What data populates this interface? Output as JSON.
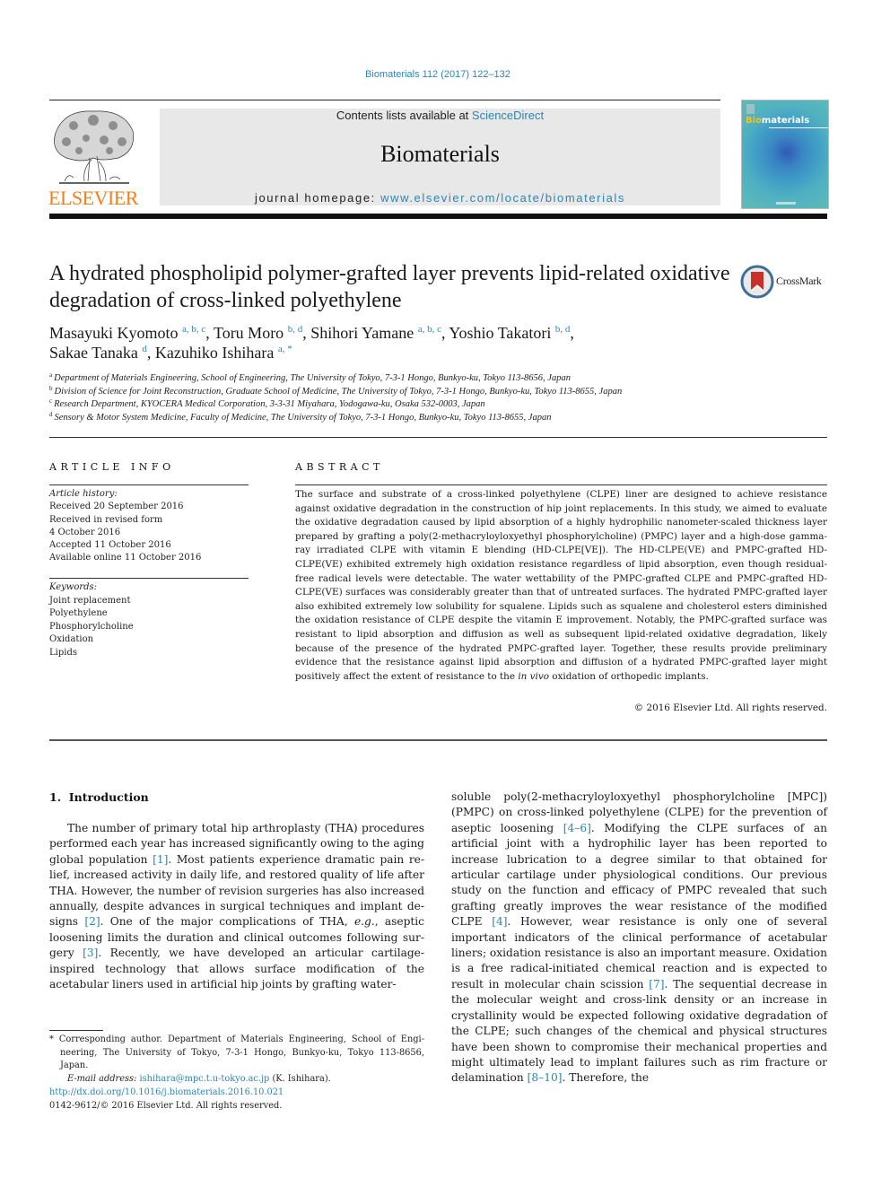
{
  "header": {
    "citation": "Biomaterials 112 (2017) 122–132",
    "publisher_logo_text": "ELSEVIER",
    "contents_prefix": "Contents lists available at ",
    "contents_link": "ScienceDirect",
    "journal_name": "Biomaterials",
    "homepage_prefix": "journal homepage: ",
    "homepage_link": "www.elsevier.com/locate/biomaterials",
    "cover_title_highlight": "Bio",
    "cover_title_rest": "materials"
  },
  "article": {
    "title": "A hydrated phospholipid polymer-grafted layer prevents lipid-related oxidative degradation of cross-linked polyethylene",
    "crossmark_label": "CrossMark",
    "authors": [
      {
        "name": "Masayuki Kyomoto",
        "sup": "a, b, c",
        "sep": ", "
      },
      {
        "name": "Toru Moro",
        "sup": "b, d",
        "sep": ", "
      },
      {
        "name": "Shihori Yamane",
        "sup": "a, b, c",
        "sep": ", "
      },
      {
        "name": "Yoshio Takatori",
        "sup": "b, d",
        "sep": ","
      },
      {
        "name": "Sakae Tanaka",
        "sup": "d",
        "sep": ", "
      },
      {
        "name": "Kazuhiko Ishihara",
        "sup": "a, *",
        "sep": ""
      }
    ],
    "affiliations": [
      {
        "key": "a",
        "text": "Department of Materials Engineering, School of Engineering, The University of Tokyo, 7-3-1 Hongo, Bunkyo-ku, Tokyo 113-8656, Japan"
      },
      {
        "key": "b",
        "text": "Division of Science for Joint Reconstruction, Graduate School of Medicine, The University of Tokyo, 7-3-1 Hongo, Bunkyo-ku, Tokyo 113-8655, Japan"
      },
      {
        "key": "c",
        "text": "Research Department, KYOCERA Medical Corporation, 3-3-31 Miyahara, Yodogawa-ku, Osaka 532-0003, Japan"
      },
      {
        "key": "d",
        "text": "Sensory & Motor System Medicine, Faculty of Medicine, The University of Tokyo, 7-3-1 Hongo, Bunkyo-ku, Tokyo 113-8655, Japan"
      }
    ]
  },
  "article_info": {
    "heading": "ARTICLE INFO",
    "history_label": "Article history:",
    "history": [
      "Received 20 September 2016",
      "Received in revised form",
      "4 October 2016",
      "Accepted 11 October 2016",
      "Available online 11 October 2016"
    ],
    "keywords_label": "Keywords:",
    "keywords": [
      "Joint replacement",
      "Polyethylene",
      "Phosphorylcholine",
      "Oxidation",
      "Lipids"
    ]
  },
  "abstract": {
    "heading": "ABSTRACT",
    "text_before_italic": "The surface and substrate of a cross-linked polyethylene (CLPE) liner are designed to achieve resistance against oxidative degradation in the construction of hip joint replacements. In this study, we aimed to evaluate the oxidative degradation caused by lipid absorption of a highly hydrophilic nanometer-scaled thickness layer prepared by grafting a poly(2-methacryloyloxyethyl phosphorylcholine) (PMPC) layer and a high-dose gamma-ray irradiated CLPE with vitamin E blending (HD-CLPE[VE]). The HD-CLPE(VE) and PMPC-grafted HD-CLPE(VE) exhibited extremely high oxidation resistance regardless of lipid ab­sorption, even though residual-free radical levels were detectable. The water wettability of the PMPC-grafted CLPE and PMPC-grafted HD-CLPE(VE) surfaces was considerably greater than that of untreated surfaces. The hydrated PMPC-grafted layer also exhibited extremely low solubility for squalene. Lipids such as squalene and cholesterol esters diminished the oxidation resistance of CLPE despite the vitamin E improvement. Notably, the PMPC-grafted surface was resistant to lipid absorption and diffusion as well as subsequent lipid-related oxidative degradation, likely because of the presence of the hydrated PMPC-grafted layer. Together, these results provide preliminary evidence that the resistance against lipid ab­sorption and diffusion of a hydrated PMPC-grafted layer might positively affect the extent of resistance to the ",
    "italic": "in vivo",
    "text_after_italic": " oxidation of orthopedic implants.",
    "copyright": "© 2016 Elsevier Ltd. All rights reserved."
  },
  "body": {
    "section_heading": "1.  Introduction",
    "left_column": [
      {
        "t": "The number of primary total hip arthroplasty (THA) procedures performed each year has increased significantly owing to the aging global population "
      },
      {
        "ref": "[1]"
      },
      {
        "t": ". Most patients experience dramatic pain re­lief, increased activity in daily life, and restored quality of life after THA. However, the number of revision surgeries has also increased annually, despite advances in surgical techniques and implant de­signs "
      },
      {
        "ref": "[2]"
      },
      {
        "t": ". One of the major complications of THA, "
      },
      {
        "i": "e.g."
      },
      {
        "t": ", aseptic loosening limits the duration and clinical outcomes following sur­gery "
      },
      {
        "ref": "[3]"
      },
      {
        "t": ". Recently, we have developed an articular cartilage-inspired technology that allows surface modification of the acetabular liners used in artificial hip joints by grafting water-"
      }
    ],
    "right_column": [
      {
        "t": "soluble poly(2-methacryloyloxyethyl phosphorylcholine [MPC]) (PMPC) on cross-linked polyethylene (CLPE) for the prevention of aseptic loosening "
      },
      {
        "ref": "[4–6]"
      },
      {
        "t": ". Modifying the CLPE surfaces of an artificial joint with a hydrophilic layer has been reported to increase lubri­cation to a degree similar to that obtained for articular cartilage under physiological conditions. Our previous study on the function and efficacy of PMPC revealed that such grafting greatly improves the wear resistance of the modified CLPE "
      },
      {
        "ref": "[4]"
      },
      {
        "t": ". However, wear resistance is only one of several important indicators of the clinical performance of acetabular liners; oxidation resistance is also an important measure. Oxidation is a free radical-initiated chemical reaction and is expected to result in molecular chain scission "
      },
      {
        "ref": "[7]"
      },
      {
        "t": ". The sequential decrease in the molecular weight and cross-link density or an increase in crystallinity would be expected following oxidative degradation of the CLPE; such changes of the chemical and physical structures have been shown to compromise their mechanical properties and might ultimately lead to implant failures such as rim fracture or delamination "
      },
      {
        "ref": "[8–10]"
      },
      {
        "t": ". Therefore, the"
      }
    ]
  },
  "footnote": {
    "corresponding": "* Corresponding author. Department of Materials Engineering, School of Engi­neering, The University of Tokyo, 7-3-1 Hongo, Bunkyo-ku, Tokyo 113-8656, Japan.",
    "email_label": "E-mail address:",
    "email": "ishihara@mpc.t.u-tokyo.ac.jp",
    "email_suffix": " (K. Ishihara).",
    "doi": "http://dx.doi.org/10.1016/j.biomaterials.2016.10.021",
    "issn_line": "0142-9612/© 2016 Elsevier Ltd. All rights reserved."
  },
  "colors": {
    "link": "#2a86b3",
    "elsevier_orange": "#f07f1c",
    "banner_gray": "#e8e8e8"
  }
}
